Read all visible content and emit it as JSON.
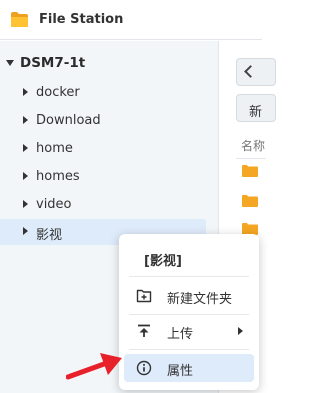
{
  "app": {
    "title": "File Station",
    "icon": "folder-icon",
    "icon_color": "#f5a623"
  },
  "sidebar": {
    "root": {
      "label": "DSM7-1t",
      "expanded": true
    },
    "items": [
      {
        "label": "docker",
        "selected": false
      },
      {
        "label": "Download",
        "selected": false
      },
      {
        "label": "home",
        "selected": false
      },
      {
        "label": "homes",
        "selected": false
      },
      {
        "label": "video",
        "selected": false
      },
      {
        "label": "影视",
        "selected": true
      }
    ],
    "selected_color": "#deebfa"
  },
  "toolbar": {
    "back_icon": "chevron-left-icon",
    "new_label": "新"
  },
  "file_list": {
    "column_header": "名称",
    "row_icon": "folder-icon",
    "visible_rows": 3
  },
  "context_menu": {
    "title": "[影视]",
    "items": [
      {
        "label": "新建文件夹",
        "icon": "new-folder-icon",
        "has_submenu": false
      },
      {
        "label": "上传",
        "icon": "upload-icon",
        "has_submenu": true
      },
      {
        "label": "属性",
        "icon": "info-icon",
        "has_submenu": false,
        "highlighted": true
      }
    ]
  },
  "annotation": {
    "icon": "red-arrow-icon",
    "color": "#e8202a"
  }
}
